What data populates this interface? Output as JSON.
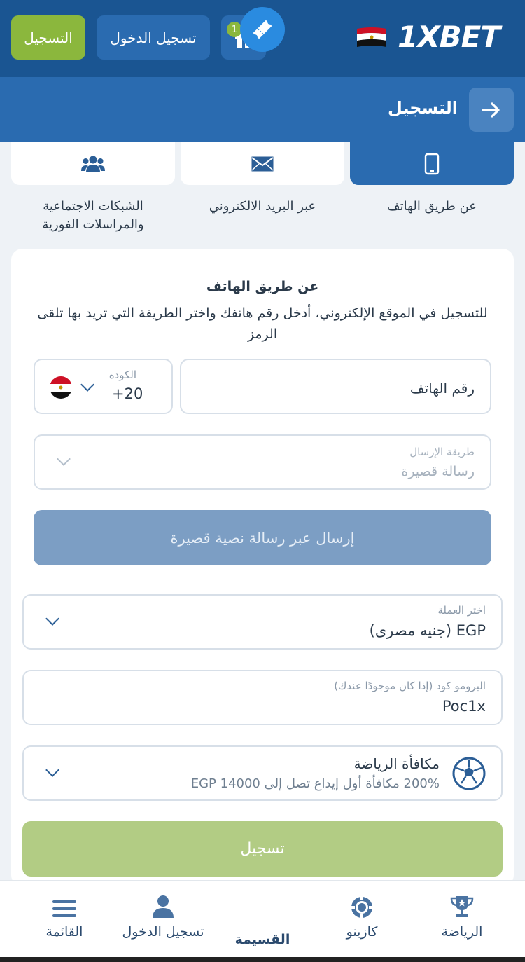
{
  "header": {
    "register_label": "التسجيل",
    "login_label": "تسجيل الدخول",
    "gift_count": "1",
    "logo_text": "1XBET"
  },
  "subheader": {
    "title": "التسجيل"
  },
  "tabs": [
    {
      "label": "عن طريق الهاتف",
      "icon": "phone-icon",
      "active": true
    },
    {
      "label": "عبر البريد الالكتروني",
      "icon": "mail-icon",
      "active": false
    },
    {
      "label_line1": "الشبكات الاجتماعية",
      "label_line2": "والمراسلات الفورية",
      "icon": "users-icon",
      "active": false
    }
  ],
  "form": {
    "title": "عن طريق الهاتف",
    "description": "للتسجيل في الموقع الإلكتروني، أدخل رقم هاتفك واختر الطريقة التي تريد بها تلقى الرمز",
    "phone_placeholder": "رقم الهاتف",
    "code_label": "الكوده",
    "code_value": "+20",
    "send_method_label": "طريقة الإرسال",
    "send_method_value": "رسالة قصيرة",
    "send_button": "إرسال عبر رسالة نصية قصيرة",
    "currency_label": "اختر العملة",
    "currency_value": "EGP (جنيه مصرى)",
    "promo_label": "البرومو كود (إذا كان موجودًا عندك)",
    "promo_value": "Poc1x",
    "bonus_title": "مكافأة الرياضة",
    "bonus_desc": "200% مكافأة أول إيداع تصل إلى 14000 EGP",
    "submit_button": "تسجيل"
  },
  "bottom_nav": {
    "menu": "القائمة",
    "login": "تسجيل الدخول",
    "coupon": "القسيمة",
    "casino": "كازينو",
    "sports": "الرياضة"
  },
  "colors": {
    "header_bg": "#1a5592",
    "subheader_bg": "#2a6bb0",
    "accent_green": "#8bb73d",
    "primary_blue": "#2a8be0"
  }
}
